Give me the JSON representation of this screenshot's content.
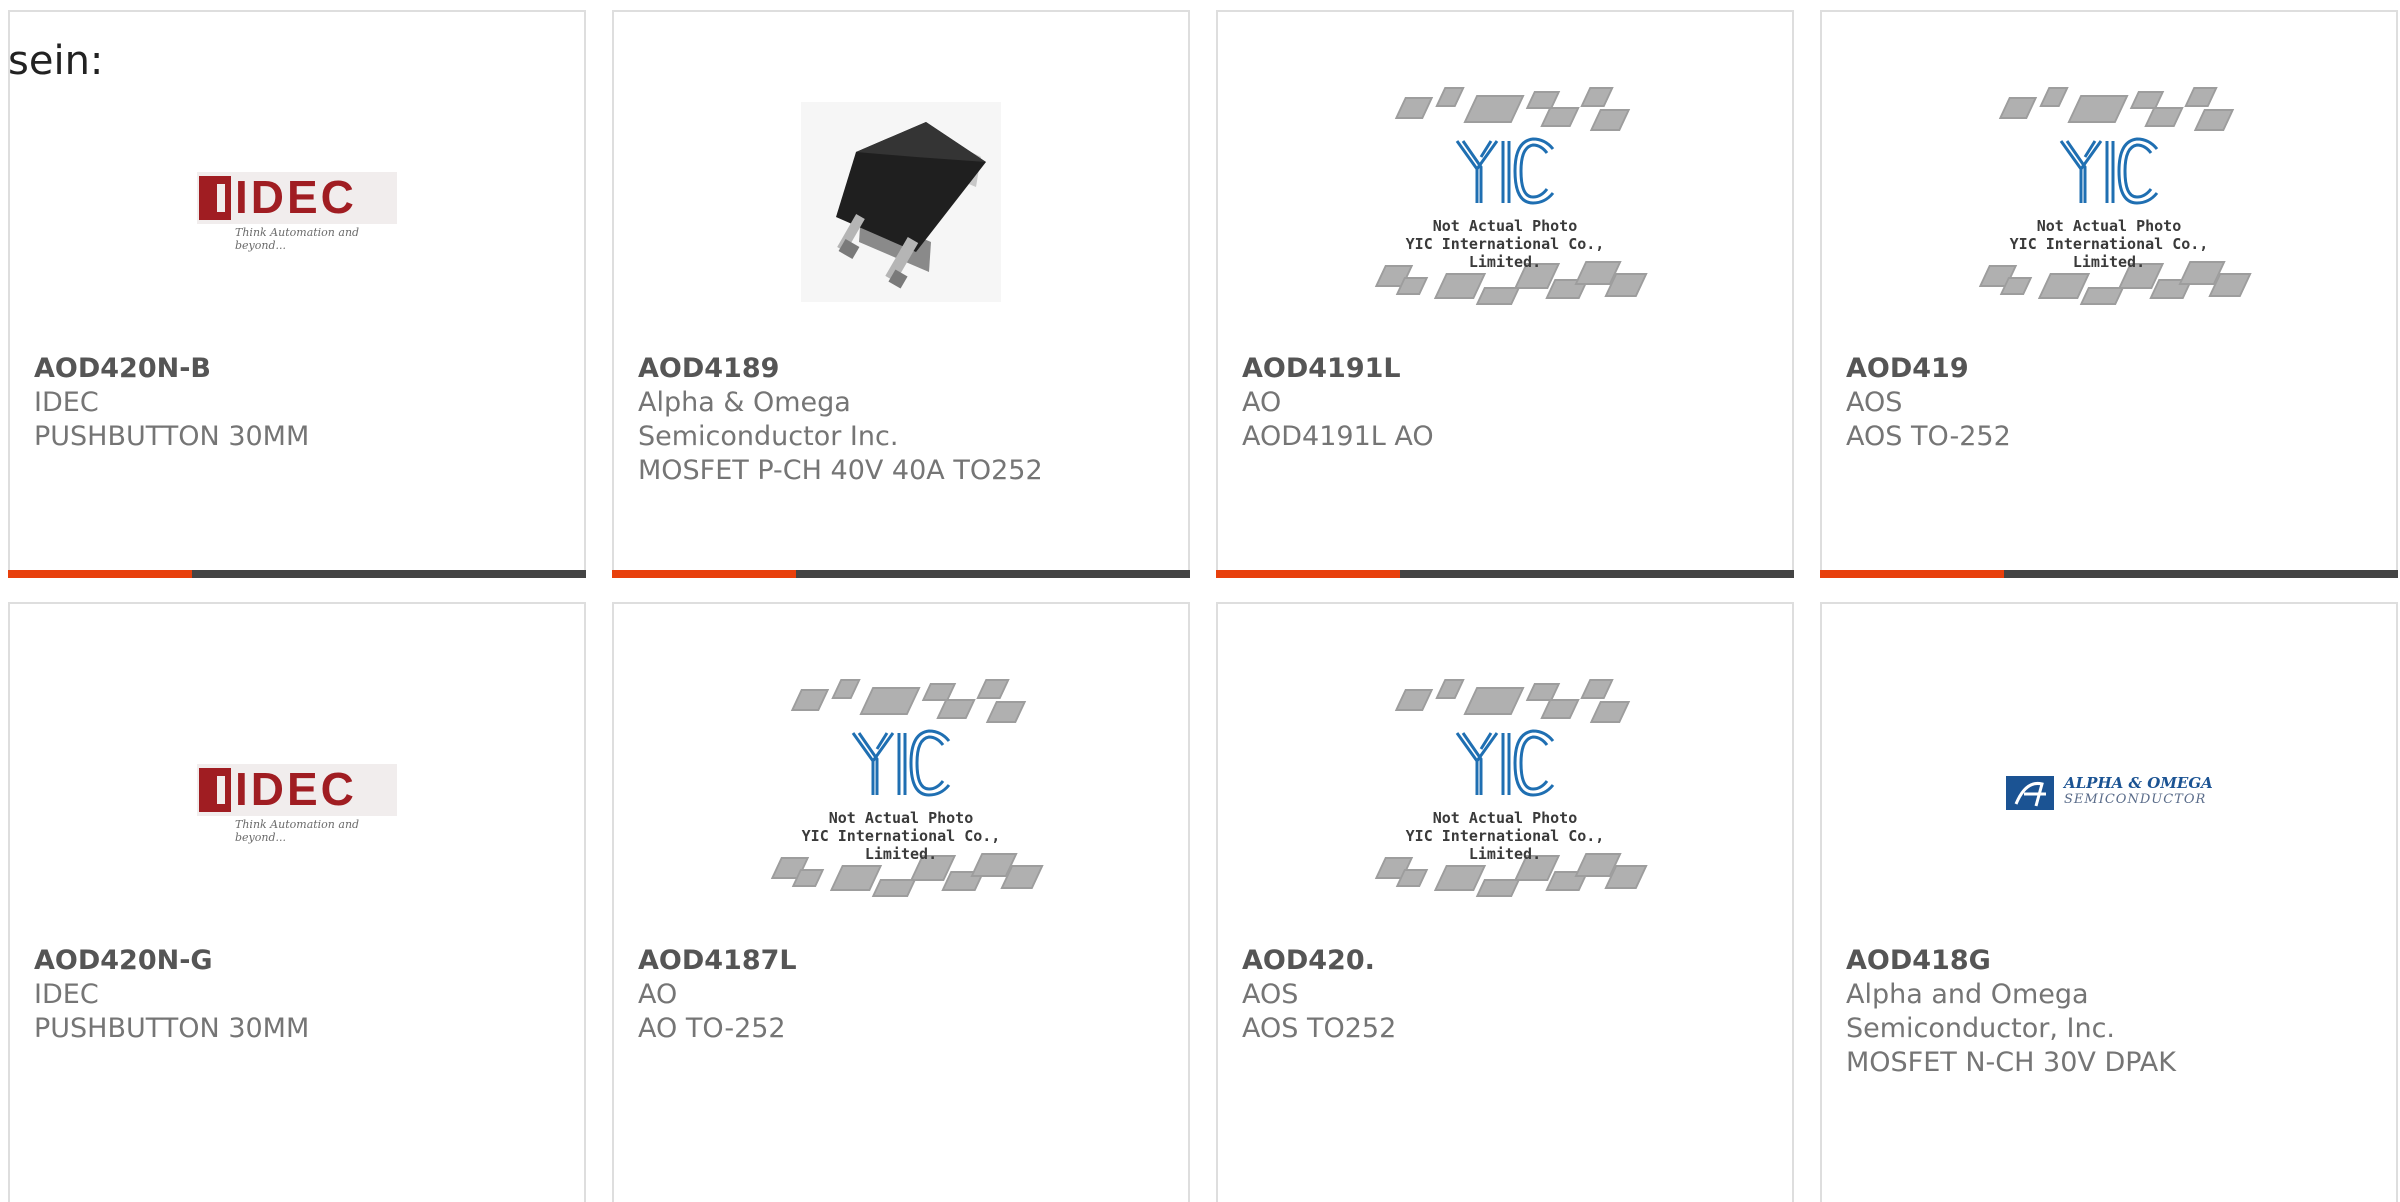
{
  "stray_text": "sein:",
  "rows": [
    [
      {
        "part_number": "AOD420N-B",
        "manufacturer": "IDEC",
        "description": "PUSHBUTTON 30MM",
        "image": "idec-logo"
      },
      {
        "part_number": "AOD4189",
        "manufacturer": "Alpha & Omega Semiconductor Inc.",
        "description": "MOSFET P-CH 40V 40A TO252",
        "image": "to252-package"
      },
      {
        "part_number": "AOD4191L",
        "manufacturer": "AO",
        "description": "AOD4191L AO",
        "image": "yic-placeholder"
      },
      {
        "part_number": "AOD419",
        "manufacturer": "AOS",
        "description": "AOS TO-252",
        "image": "yic-placeholder"
      }
    ],
    [
      {
        "part_number": "AOD420N-G",
        "manufacturer": "IDEC",
        "description": "PUSHBUTTON 30MM",
        "image": "idec-logo"
      },
      {
        "part_number": "AOD4187L",
        "manufacturer": "AO",
        "description": "AO TO-252",
        "image": "yic-placeholder"
      },
      {
        "part_number": "AOD420.",
        "manufacturer": "AOS",
        "description": "AOS TO252",
        "image": "yic-placeholder"
      },
      {
        "part_number": "AOD418G",
        "manufacturer": "Alpha and Omega Semiconductor, Inc.",
        "description": "MOSFET N-CH 30V DPAK",
        "image": "alpha-omega-logo"
      }
    ]
  ],
  "logos": {
    "idec": {
      "word": "IDEC",
      "tagline": "Think Automation and beyond..."
    },
    "yic": {
      "line1": "Not Actual Photo",
      "line2": "YIC International Co., Limited."
    },
    "alpha_omega": {
      "line1": "ALPHA & OMEGA",
      "line2": "SEMICONDUCTOR"
    }
  },
  "colors": {
    "accent_bar": "#e8400c",
    "dark_bar": "#444444",
    "idec_red": "#a01d22",
    "ao_blue": "#1b5393",
    "yic_blue": "#1f6fb2"
  }
}
